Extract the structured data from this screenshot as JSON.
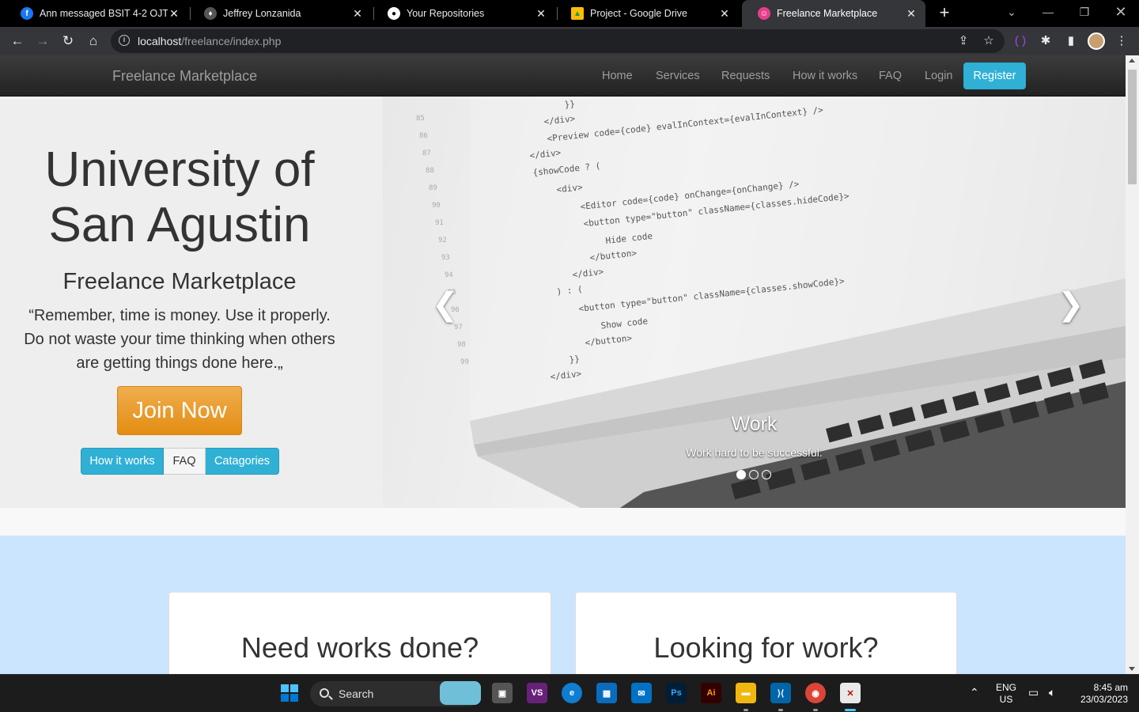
{
  "browser": {
    "tabs": [
      {
        "title": "Ann messaged BSIT 4-2 OJT",
        "icon": "facebook-icon",
        "color": "#1877f2",
        "glyph": "f"
      },
      {
        "title": "Jeffrey Lonzanida",
        "icon": "mask-icon",
        "color": "#8a8a8a",
        "glyph": "♦"
      },
      {
        "title": "Your Repositories",
        "icon": "github-icon",
        "color": "#ffffff",
        "glyph": "●"
      },
      {
        "title": "Project - Google Drive",
        "icon": "google-drive-icon",
        "color": "#fbbc04",
        "glyph": "▲"
      },
      {
        "title": "Freelance Marketplace",
        "icon": "smiley-favicon-icon",
        "color": "#e83e8c",
        "glyph": "☺"
      }
    ],
    "active_tab": 4,
    "url_host": "localhost",
    "url_path": "/freelance/index.php"
  },
  "site": {
    "brand": "Freelance Marketplace",
    "nav": [
      "Home",
      "Services",
      "Requests",
      "How it works",
      "FAQ",
      "Login"
    ],
    "register_label": "Register",
    "register_color": "#31b0d5"
  },
  "hero": {
    "title_line1": "University of",
    "title_line2": "San Agustin",
    "subtitle": "Freelance Marketplace",
    "quote_line1": "“Remember, time is money. Use it properly.",
    "quote_line2": "Do not waste your time thinking when others",
    "quote_line3": "are getting things done here.„",
    "join_label": "Join Now",
    "join_color": "#f0ad4e",
    "buttons": [
      "How it works",
      "FAQ",
      "Catagories"
    ]
  },
  "carousel": {
    "caption_title": "Work",
    "caption_text": "Work hard to be successful.",
    "slide_count": 3,
    "active_slide": 1,
    "code_lines": [
      "}}",
      "</div>",
      "<Preview code={code} evalInContext={evalInContext} />",
      "</div>",
      "{showCode ? (",
      "<div>",
      "<Editor code={code} onChange={onChange} />",
      "<button type=\"button\" className={classes.hideCode}>",
      "Hide code",
      "</button>",
      "</div>",
      ") : (",
      "<button type=\"button\" className={classes.showCode}>",
      "Show code",
      "</button>",
      "}}",
      "</div>"
    ]
  },
  "cards": [
    {
      "title": "Need works done?"
    },
    {
      "title": "Looking for work?"
    }
  ],
  "taskbar": {
    "search_label": "Search",
    "lang_line1": "ENG",
    "lang_line2": "US",
    "time": "8:45 am",
    "date": "23/03/2023"
  }
}
